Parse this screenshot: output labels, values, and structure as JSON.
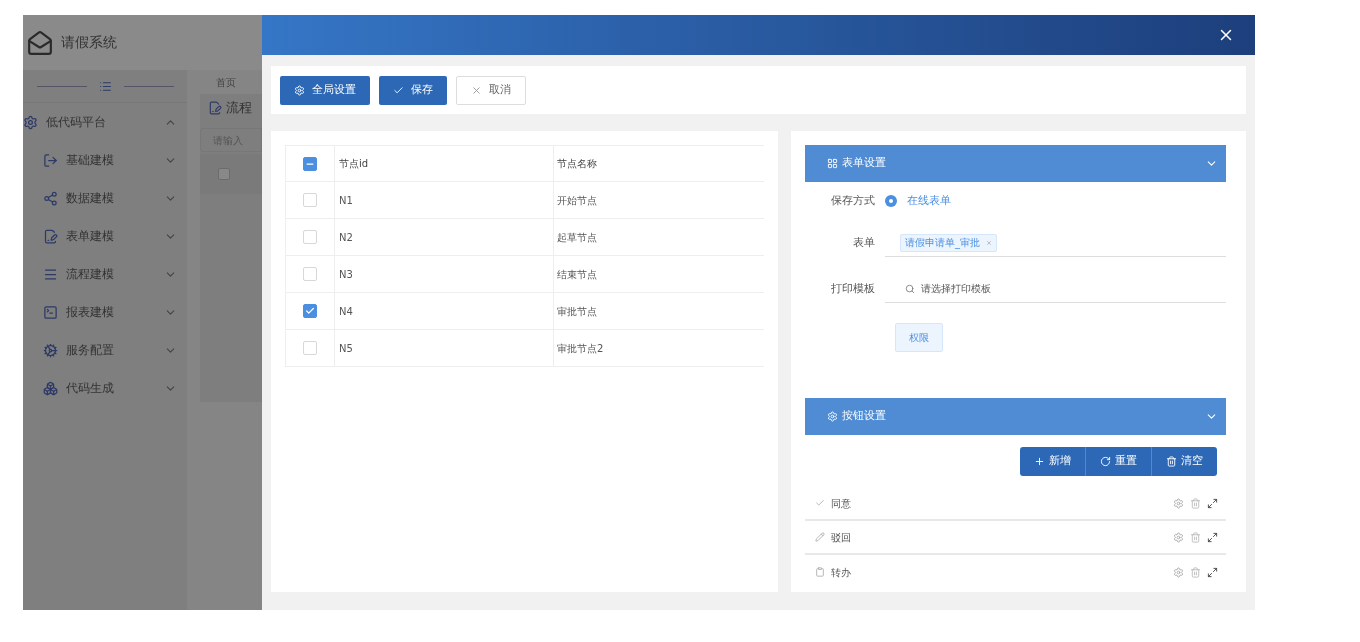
{
  "app": {
    "title": "请假系统",
    "menu": [
      {
        "label": "低代码平台",
        "expanded": true,
        "children": [
          {
            "label": "基础建模",
            "expanded": false
          },
          {
            "label": "数据建模",
            "expanded": false
          },
          {
            "label": "表单建模",
            "expanded": false
          },
          {
            "label": "流程建模",
            "expanded": false
          },
          {
            "label": "报表建模",
            "expanded": false
          },
          {
            "label": "服务配置",
            "expanded": false
          },
          {
            "label": "代码生成",
            "expanded": false
          }
        ]
      }
    ],
    "tab": "首页",
    "panel_title": "流程",
    "search_placeholder": "请输入",
    "header_checked": false
  },
  "dialog": {
    "toolbar": [
      {
        "label": "全局设置",
        "kind": "primary"
      },
      {
        "label": "保存",
        "kind": "primary"
      },
      {
        "label": "取消",
        "kind": "default"
      }
    ],
    "table": {
      "columns": [
        "节点id",
        "节点名称"
      ],
      "header_indeterminate": true,
      "rows": [
        {
          "id": "N1",
          "name": "开始节点",
          "checked": false
        },
        {
          "id": "N2",
          "name": "起草节点",
          "checked": false
        },
        {
          "id": "N3",
          "name": "结束节点",
          "checked": false
        },
        {
          "id": "N4",
          "name": "审批节点",
          "checked": true
        },
        {
          "id": "N5",
          "name": "审批节点2",
          "checked": false
        }
      ]
    },
    "form_settings": {
      "title": "表单设置",
      "save_mode": {
        "label": "保存方式",
        "option": "在线表单",
        "selected": true
      },
      "form": {
        "label": "表单",
        "tag": "请假申请单_审批"
      },
      "print_template": {
        "label": "打印模板",
        "placeholder": "请选择打印模板"
      },
      "permission_button": "权限"
    },
    "button_settings": {
      "title": "按钮设置",
      "actions": [
        "新增",
        "重置",
        "清空"
      ],
      "items": [
        {
          "label": "同意"
        },
        {
          "label": "驳回"
        },
        {
          "label": "转办"
        }
      ]
    }
  }
}
